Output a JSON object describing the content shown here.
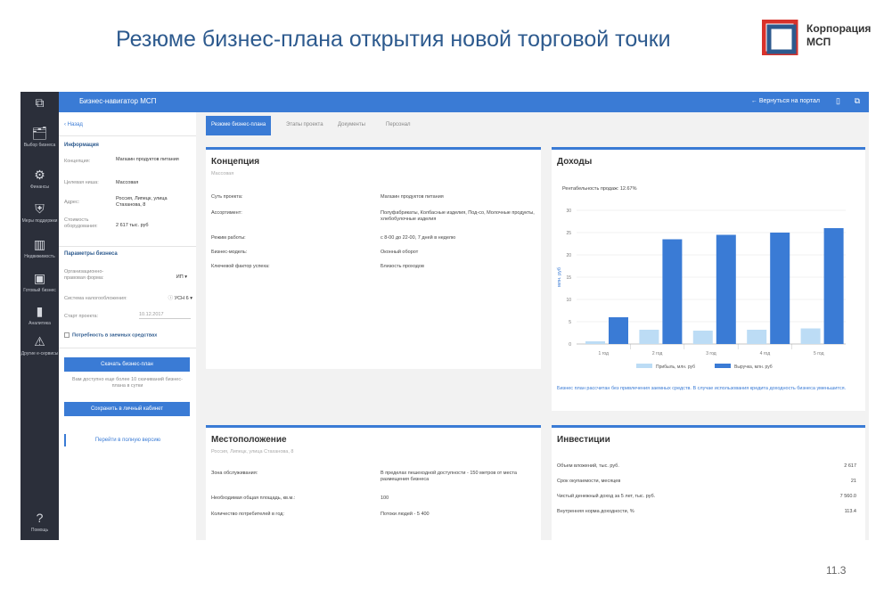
{
  "slide": {
    "title": "Резюме бизнес-плана открытия новой торговой точки",
    "logo_line1": "Корпорация",
    "logo_line2": "МСП",
    "page_number": "11.3"
  },
  "app": {
    "title": "Бизнес-навигатор МСП",
    "back_to_portal": "← Вернуться на портал",
    "leftbar": [
      {
        "icon": "🗂",
        "label": "Выбор бизнеса"
      },
      {
        "icon": "⚙",
        "label": "Финансы"
      },
      {
        "icon": "⛨",
        "label": "Меры поддержки"
      },
      {
        "icon": "▥",
        "label": "Недвижимость"
      },
      {
        "icon": "▣",
        "label": "Готовый бизнес"
      },
      {
        "icon": "▮",
        "label": "Аналитика"
      },
      {
        "icon": "⚠",
        "label": "Другие е-сервисы"
      }
    ],
    "help_label": "Помощь",
    "help_icon": "?"
  },
  "left_panel": {
    "back": "‹ Назад",
    "info_title": "Информация",
    "info": [
      {
        "label": "Концепция:",
        "value": "Магазин продуктов питания"
      },
      {
        "label": "Целевая ниша:",
        "value": "Массовая"
      },
      {
        "label": "Адрес:",
        "value": "Россия, Липецк, улица Стаханова, 8"
      },
      {
        "label": "Стоимость оборудования:",
        "value": "2 617 тыс. руб"
      }
    ],
    "params_title": "Параметры бизнеса",
    "params": [
      {
        "label": "Организационно-правовая форма:",
        "value": "ИП ▾"
      },
      {
        "label": "Система налогообложения:",
        "value": "УСН 6 ▾"
      },
      {
        "label": "Старт проекта:",
        "value": "10.12.2017"
      }
    ],
    "borrowed_checkbox": "Потребность в заемных средствах",
    "download_button": "Скачать бизнес-план",
    "download_note": "Вам доступно еще более 10 скачиваний бизнес-плана в сутки",
    "save_button": "Сохранить в личный кабинет",
    "full_link": "Перейти в полную версию"
  },
  "tabs": [
    {
      "label": "Резюме бизнес-плана",
      "active": true
    },
    {
      "label": "Этапы проекта",
      "active": false
    },
    {
      "label": "Документы",
      "active": false
    },
    {
      "label": "Персонал",
      "active": false
    }
  ],
  "concept": {
    "title": "Концепция",
    "subtitle": "Массовая",
    "rows": [
      {
        "label": "Суть проекта:",
        "value": "Магазин продуктов питания"
      },
      {
        "label": "Ассортимент:",
        "value": "Полуфабрикаты, Колбасные изделия, Под-со, Молочные продукты, хлебобулочные изделия"
      },
      {
        "label": "Режим работы:",
        "value": "с 8-00 до 22-00, 7 дней в неделю"
      },
      {
        "label": "Бизнес-модель:",
        "value": "Оконный оборот"
      },
      {
        "label": "Ключевой фактор успеха:",
        "value": "Близость проходов"
      }
    ]
  },
  "income": {
    "title": "Доходы",
    "caption": "Рентабельность продаж: 12.67%",
    "note": "Бизнес план рассчитан без привлечения заемных средств. В случае использования кредита доходность бизнеса уменьшится."
  },
  "chart_data": {
    "type": "bar",
    "categories": [
      "1 год",
      "2 год",
      "3 год",
      "4 год",
      "5 год"
    ],
    "ylabel": "млн. руб",
    "ylim": [
      0,
      30
    ],
    "yticks": [
      0,
      5,
      10,
      15,
      20,
      25,
      30
    ],
    "series": [
      {
        "name": "Прибыль, млн. руб",
        "color": "#bcdcf5",
        "values": [
          0.6,
          3.2,
          3.0,
          3.2,
          3.5
        ]
      },
      {
        "name": "Выручка, млн. руб",
        "color": "#3a7bd5",
        "values": [
          6.0,
          23.5,
          24.5,
          25.0,
          26.0
        ]
      }
    ]
  },
  "location": {
    "title": "Местоположение",
    "subtitle": "Россия, Липецк, улица Стаханова, 8",
    "rows": [
      {
        "label": "Зона обслуживания:",
        "value": "В пределах пешеходной доступности - 150 метров от места размещения бизнеса"
      },
      {
        "label": "Необходимая общая площадь, кв.м.:",
        "value": "100"
      },
      {
        "label": "Количество потребителей в год:",
        "value": "Потоки людей - 5 400"
      }
    ]
  },
  "investments": {
    "title": "Инвестиции",
    "rows": [
      {
        "label": "Объем вложений, тыс. руб.",
        "value": "2 617"
      },
      {
        "label": "Срок окупаемости, месяцев",
        "value": "21"
      },
      {
        "label": "Чистый денежный доход за 5 лет, тыс. руб.",
        "value": "7 560.0"
      },
      {
        "label": "Внутренняя норма доходности, %",
        "value": "113.4"
      }
    ]
  }
}
